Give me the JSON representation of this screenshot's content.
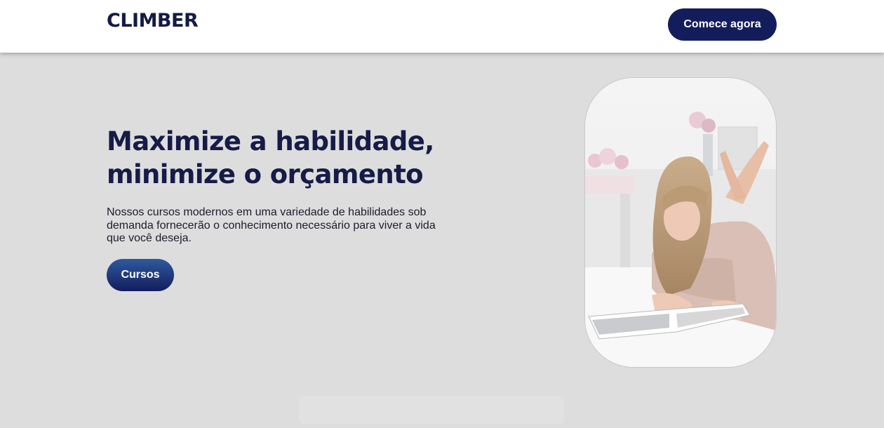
{
  "header": {
    "logo": "CLIMBER",
    "cta_label": "Comece agora"
  },
  "hero": {
    "title_line1": "Maximize a habilidade,",
    "title_line2": "minimize o orçamento",
    "description": "Nossos cursos modernos em uma variedade de habilidades sob demanda fornecerão o conhecimento necessário para viver a vida que você deseja.",
    "button_label": "Cursos",
    "image_alt": "woman-reading-magazine-photo"
  },
  "colors": {
    "brand_navy": "#141d5c",
    "page_bg": "#dddddd",
    "header_bg": "#ffffff"
  }
}
